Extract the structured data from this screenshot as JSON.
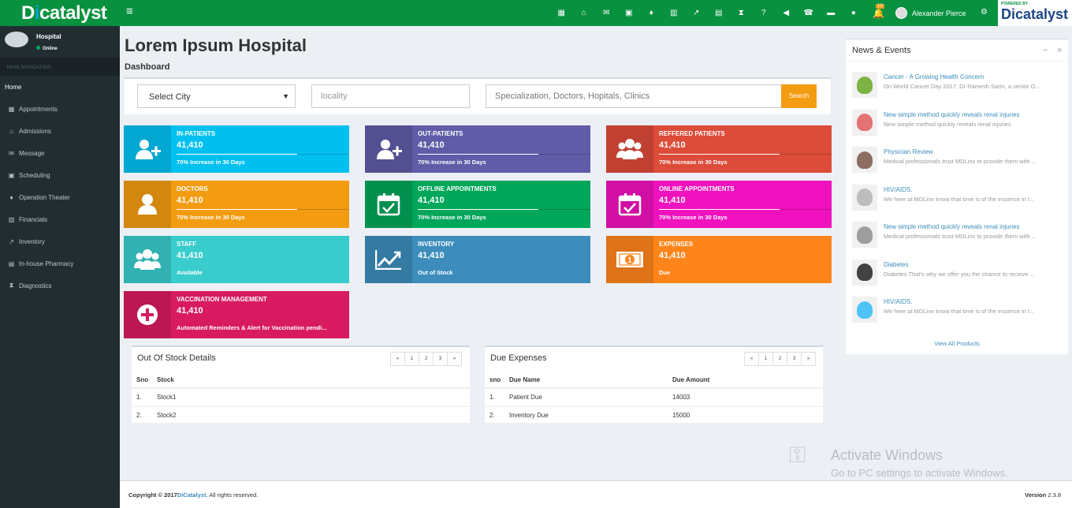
{
  "header": {
    "logo": "Dicatalyst",
    "user_name": "Alexander Pierce",
    "notif_count": "10",
    "brand_powered": "POWERED BY",
    "brand_name": "Dicatalyst",
    "nav_icons": [
      "calendar-icon",
      "bank-icon",
      "mail-icon",
      "calendar-check-icon",
      "map-pin-icon",
      "bar-chart-icon",
      "line-chart-icon",
      "calculator-icon",
      "hourglass-icon",
      "help-icon",
      "megaphone-icon",
      "phone-icon",
      "card-icon",
      "chat-icon"
    ]
  },
  "sidebar": {
    "user_name": "Hospital",
    "status": "Online",
    "section": "MAIN NAVIGATION",
    "items": [
      {
        "label": "Home",
        "icon": "home-icon"
      },
      {
        "label": "Appointments",
        "icon": "calendar-icon"
      },
      {
        "label": "Admissions",
        "icon": "bank-icon"
      },
      {
        "label": "Message",
        "icon": "mail-icon"
      },
      {
        "label": "Scheduling",
        "icon": "calendar-check-icon"
      },
      {
        "label": "Operation Theater",
        "icon": "map-pin-icon"
      },
      {
        "label": "Financials",
        "icon": "bar-chart-icon"
      },
      {
        "label": "Inventory",
        "icon": "line-chart-icon"
      },
      {
        "label": "In-house Pharmacy",
        "icon": "calculator-icon"
      },
      {
        "label": "Diagnostics",
        "icon": "hourglass-icon"
      }
    ]
  },
  "page": {
    "title": "Lorem Ipsum Hospital",
    "subtitle": "Dashboard"
  },
  "search": {
    "city": "Select City",
    "locality_placeholder": "locality",
    "spec_placeholder": "Specialization, Doctors, Hopitals, Clinics",
    "button": "Search"
  },
  "tiles": [
    {
      "title": "IN-PATIENTS",
      "value": "41,410",
      "desc": "70% Increase in 30 Days",
      "color": "#00c0ef",
      "icon": "add-user-icon",
      "progress": 0.7
    },
    {
      "title": "OUT-PATIENTS",
      "value": "41,410",
      "desc": "70% Increase in 30 Days",
      "color": "#605ca8",
      "icon": "add-user-icon",
      "progress": 0.7
    },
    {
      "title": "REFFERED PATIENTS",
      "value": "41,410",
      "desc": "70% Increase in 30 Days",
      "color": "#dd4b39",
      "icon": "users-icon",
      "progress": 0.7
    },
    {
      "title": "DOCTORS",
      "value": "41,410",
      "desc": "70% Increase in 30 Days",
      "color": "#f39c12",
      "icon": "user-icon",
      "progress": 0.7
    },
    {
      "title": "OFFLINE APPOINTMENTS",
      "value": "41,410",
      "desc": "70% Increase in 30 Days",
      "color": "#00a65a",
      "icon": "calendar-check-icon",
      "progress": 0.7
    },
    {
      "title": "ONLINE APPOINTMENTS",
      "value": "41,410",
      "desc": "70% Increase in 30 Days",
      "color": "#f012be",
      "icon": "calendar-check-icon",
      "progress": 0.7
    },
    {
      "title": "STAFF",
      "value": "41,410",
      "desc": "Available",
      "color": "#39cccc",
      "icon": "users-icon",
      "progress": 0
    },
    {
      "title": "INVENTORY",
      "value": "41,410",
      "desc": "Out of Stock",
      "color": "#3c8dbc",
      "icon": "line-chart-icon",
      "progress": 0
    },
    {
      "title": "EXPENSES",
      "value": "41,410",
      "desc": "Due",
      "color": "#ff851b",
      "icon": "money-icon",
      "progress": 0
    },
    {
      "title": "VACCINATION MANAGEMENT",
      "value": "41,410",
      "desc": "Automated Reminders & Alert for Vaccination pendi...",
      "color": "#d81b60",
      "icon": "plus-circle-icon",
      "progress": 0
    }
  ],
  "stock": {
    "title": "Out Of Stock Details",
    "headers": [
      "Sno",
      "Stock"
    ],
    "rows": [
      [
        "1.",
        "Stock1"
      ],
      [
        "2.",
        "Stock2"
      ]
    ]
  },
  "expenses": {
    "title": "Due Expenses",
    "headers": [
      "sno",
      "Due Name",
      "Due Amount"
    ],
    "rows": [
      [
        "1.",
        "Patient Due",
        "14003"
      ],
      [
        "2.",
        "Inventory Due",
        "15000"
      ]
    ]
  },
  "pager": [
    "«",
    "1",
    "2",
    "3",
    "»"
  ],
  "news": {
    "title": "News & Events",
    "items": [
      {
        "title": "Cancer - A Growing Health Concern",
        "desc": "On World Cancer Day 2017, Dr Ramesh Sarin, a senior O..."
      },
      {
        "title": "New simple method quickly reveals renal injuries",
        "desc": "New simple method quickly reveals renal injuries"
      },
      {
        "title": "Physician Review",
        "desc": "Medical professionals trust MDLinx to provide them with ..."
      },
      {
        "title": "HIV/AIDS.",
        "desc": "We here at MDLinx know that time is of the essence in t..."
      },
      {
        "title": "New simple method quickly reveals renal injuries",
        "desc": "Medical professionals trust MDLinx to provide them with ..."
      },
      {
        "title": "Diabetes",
        "desc": "Diabetes That's why we offer you the chance to receive ..."
      },
      {
        "title": "HIV/AIDS.",
        "desc": "We here at MDLinx know that time is of the essence in t..."
      }
    ],
    "view_all": "View All Products"
  },
  "watermark": {
    "line1": "Activate Windows",
    "line2": "Go to PC settings to activate Windows."
  },
  "footer": {
    "copy": "Copyright © 2017",
    "brand": "DiCatalyst.",
    "rights": " All rights reserved.",
    "version_label": "Version",
    "version": " 2.3.8"
  }
}
